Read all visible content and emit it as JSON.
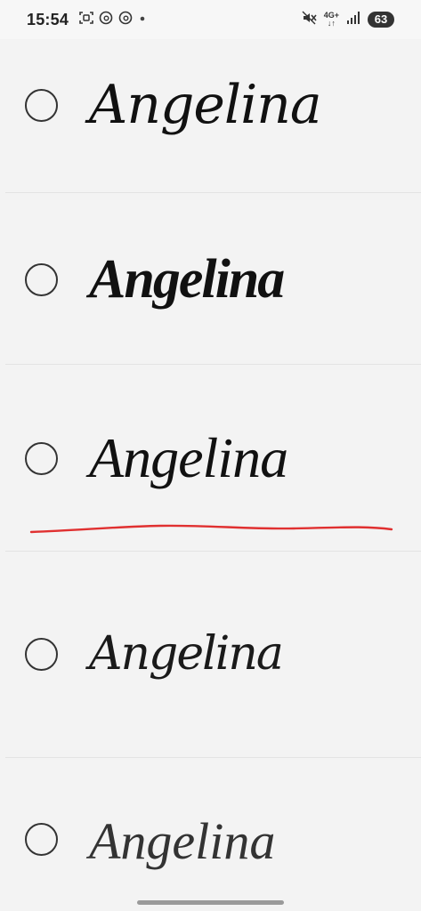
{
  "status_bar": {
    "time": "15:54",
    "left_icons": [
      "screenshot-icon",
      "threads-icon",
      "threads-icon",
      "notification-dot-icon"
    ],
    "network_label_top": "4G+",
    "network_label_bottom": "↓↑",
    "right_icons": [
      "mute-icon",
      "signal-bars-icon"
    ],
    "battery_level": "63"
  },
  "options": [
    {
      "label": "Angelina",
      "selected": false
    },
    {
      "label": "Angelina",
      "selected": false
    },
    {
      "label": "Angelina",
      "selected": false
    },
    {
      "label": "Angelina",
      "selected": false
    },
    {
      "label": "Angelina",
      "selected": false
    }
  ],
  "annotation": {
    "underline_color": "#e03030"
  }
}
